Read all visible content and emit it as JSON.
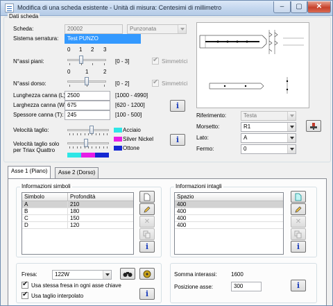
{
  "window": {
    "title": "Modifica di una scheda esistente - Unità di misura: Centesimi di millimetro",
    "minimize_glyph": "–",
    "maximize_glyph": "▢",
    "close_glyph": "✕"
  },
  "dati_scheda": {
    "group_title": "Dati scheda",
    "scheda_label": "Scheda:",
    "scheda_value": "20002",
    "tipo_value": "Punzonata",
    "sistema_label": "Sistema serratura:",
    "sistema_value": "Test PUNZO",
    "assi_piani_label": "N°assi piani:",
    "assi_piani_ticks": [
      "0",
      "1",
      "2",
      "3"
    ],
    "assi_piani_value": 1,
    "assi_piani_range": "[0 - 3]",
    "assi_dorso_label": "N°assi dorso:",
    "assi_dorso_ticks": [
      "0",
      "1",
      "2"
    ],
    "assi_dorso_value": 1,
    "assi_dorso_range": "[0 - 2]",
    "simmetrici_label": "Simmetrici",
    "lunghezza_label": "Lunghezza canna (L):",
    "lunghezza_value": "2500",
    "lunghezza_range": "[1000 - 4990]",
    "larghezza_label": "Larghezza canna (W):",
    "larghezza_value": "675",
    "larghezza_range": "[620 - 1200]",
    "spessore_label": "Spessore canna (T):",
    "spessore_value": "245",
    "spessore_range": "[100 - 500]",
    "velocita_label": "Velocità taglio:",
    "velocita_value": 0.6,
    "velocita_triax_label": "Velocità taglio solo per Triax Quattro",
    "velocita_triax_value": 0.45,
    "materials": [
      {
        "label": "Acciaio",
        "color": "#2ee6e6"
      },
      {
        "label": "Silver Nickel",
        "color": "#e61ee6"
      },
      {
        "label": "Ottone",
        "color": "#1428d2"
      }
    ],
    "riferimento_label": "Riferimento:",
    "riferimento_value": "Testa",
    "morsetto_label": "Morsetto:",
    "morsetto_value": "R1",
    "lato_label": "Lato:",
    "lato_value": "A",
    "fermo_label": "Fermo:",
    "fermo_value": "0",
    "info_glyph": "i"
  },
  "tabs": [
    {
      "label": "Asse 1 (Piano)"
    },
    {
      "label": "Asse 2 (Dorso)"
    }
  ],
  "simboli": {
    "group_title": "Informazioni simboli",
    "columns": [
      "Simbolo",
      "Profondità"
    ],
    "rows": [
      [
        "A",
        "210"
      ],
      [
        "B",
        "180"
      ],
      [
        "C",
        "150"
      ],
      [
        "D",
        "120"
      ]
    ],
    "buttons": {
      "new": "new-doc-icon",
      "edit": "pencil-icon",
      "delete": "delete-x-icon",
      "copy": "copy-icon",
      "info": "info-icon"
    }
  },
  "intagli": {
    "group_title": "Informazioni intagli",
    "columns": [
      "Spazio"
    ],
    "rows": [
      [
        "400"
      ],
      [
        "400"
      ],
      [
        "400"
      ],
      [
        "400"
      ]
    ]
  },
  "fresa": {
    "label": "Fresa:",
    "value": "122W",
    "usa_stessa_label": "Usa stessa fresa in ogni asse chiave",
    "usa_stessa_checked": true,
    "usa_taglio_label": "Usa taglio interpolato",
    "usa_taglio_checked": true,
    "check_glyph": "✔"
  },
  "interassi": {
    "somma_label": "Somma interassi:",
    "somma_value": "1600",
    "posizione_label": "Posizione asse:",
    "posizione_value": "300"
  }
}
